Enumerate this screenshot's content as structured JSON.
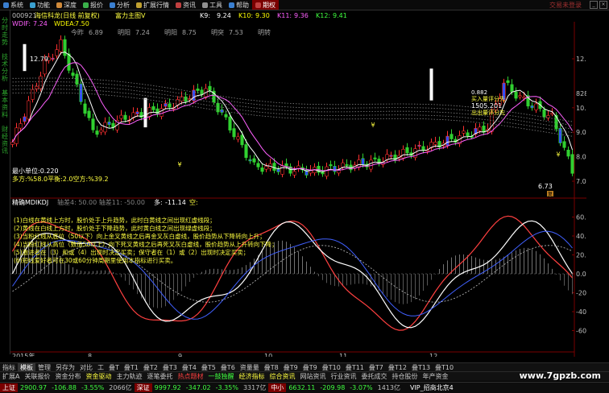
{
  "menu": {
    "items": [
      {
        "label": "系统",
        "color": "#3a7fd0"
      },
      {
        "label": "功能",
        "color": "#3aa0d0"
      },
      {
        "label": "深度",
        "color": "#d08a3a"
      },
      {
        "label": "报价",
        "color": "#3ab04a"
      },
      {
        "label": "分析",
        "color": "#3a7fd0"
      },
      {
        "label": "扩展行情",
        "color": "#c0a030"
      },
      {
        "label": "资讯",
        "color": "#c04040"
      },
      {
        "label": "工具",
        "color": "#909090"
      },
      {
        "label": "帮助",
        "color": "#3a7fd0"
      },
      {
        "label": "期权",
        "color": "#c04040"
      }
    ],
    "watermark": "交易未登录"
  },
  "left_tabs": [
    "分时走势",
    "技术分析",
    "基本资料",
    "财经资讯"
  ],
  "header": {
    "code": "000921",
    "name": "海信科龙(日线 前复权)",
    "indicator": "富力主图V",
    "ma": [
      {
        "label": "K9:",
        "value": "9.24",
        "color": "#ffffff"
      },
      {
        "label": "K10:",
        "value": "9.30",
        "color": "#ffff00"
      },
      {
        "label": "K11:",
        "value": "9.36",
        "color": "#ff60ff"
      },
      {
        "label": "K12:",
        "value": "9.41",
        "color": "#40ff40"
      }
    ],
    "sub": [
      {
        "label": "WDIF:",
        "value": "7.24",
        "color": "#ff60ff"
      },
      {
        "label": "WDEA:",
        "value": "7.50",
        "color": "#ffff00"
      }
    ],
    "row3": [
      {
        "label": "今昨",
        "value": "6.89"
      },
      {
        "label": "明阳",
        "value": "7.24"
      },
      {
        "label": "明阳",
        "value": "8.75"
      },
      {
        "label": "明突",
        "value": "7.53"
      },
      {
        "label": "明转",
        "value": ""
      }
    ]
  },
  "price_chart": {
    "high_label": "12.79",
    "info_lines": [
      "最小单位:0.220",
      "多方:%58.0平衡:2.0空方:%39.2"
    ],
    "right_notes": [
      "0.882",
      "买入量评分先",
      "1505.201",
      "出出量评分先"
    ],
    "low_label": "6.73",
    "low_badge": "复"
  },
  "indicator_panel": {
    "name": "精确MDIKDJ",
    "params": "轴差4: 50.00  轴差11: -50.00",
    "signal_label": "多:",
    "signal_value": "-11.14",
    "signal_empty": "空:",
    "notes": [
      "(1)白线在黄线上方时，股价处于上升趋势，此时白黄线之间出现红虚线段；",
      "(2)黄线在白线上方时，股价处于下降趋势，此时黄白线之间出现绿虚线段；",
      "(3)当粉红线从底位（50以下）向上金叉黄线之后再金叉灰白虚线，股价趋势从下降转向上升；",
      "(4)当粉红线从高位（数值50以上）向下死叉黄线之后再死叉灰白虚线，股价趋势从上升转向下降；",
      "(5)激进者在（3）和或（4）出现时决定买卖；保守者在（1）或（2）出现时决定买卖；",
      "(6)短线爱好者可在30或60分钟周期里使用本指标进行买卖。"
    ]
  },
  "axis": {
    "price_ticks": [
      "12.00",
      "10.00",
      "9.00",
      "8.00",
      "7.00"
    ],
    "top_value": "828",
    "ind_ticks": [
      "60.00",
      "40.00",
      "20.00",
      "0.00",
      "-20.00",
      "-40.00",
      "-60.00"
    ],
    "date_labels": [
      "2015年",
      "8",
      "9",
      "10",
      "11",
      "12"
    ]
  },
  "tabs_row1": [
    "指标",
    "模板",
    "管理",
    "另存为",
    "对比",
    "工",
    "叠T",
    "叠T1",
    "叠T2",
    "叠T3",
    "叠T4",
    "叠T5",
    "叠T6",
    "资量量",
    "叠T8",
    "叠T9",
    "叠T9",
    "叠T10",
    "叠T11",
    "叠T7",
    "叠T12",
    "叠T13",
    "叠T10"
  ],
  "tabs_row2": [
    {
      "label": "扩展A",
      "color": "#c8c8c8"
    },
    {
      "label": "关联报价",
      "color": "#c8c8c8"
    },
    {
      "label": "资金分布",
      "color": "#c8c8c8"
    },
    {
      "label": "资金驱动",
      "color": "#ffff40"
    },
    {
      "label": "主力轨迹",
      "color": "#c8c8c8"
    },
    {
      "label": "逐笔委托",
      "color": "#c8c8c8"
    },
    {
      "label": "热点题材",
      "color": "#ff4040"
    },
    {
      "label": "一鼓独醒",
      "color": "#40ff40"
    },
    {
      "label": "经济指标",
      "color": "#ffff40"
    },
    {
      "label": "综合资讯",
      "color": "#ffff40"
    },
    {
      "label": "网站资讯",
      "color": "#c8c8c8"
    },
    {
      "label": "行业资讯",
      "color": "#c8c8c8"
    },
    {
      "label": "委托成交",
      "color": "#c8c8c8"
    },
    {
      "label": "持仓股份",
      "color": "#c8c8c8"
    },
    {
      "label": "年产资金",
      "color": "#c8c8c8"
    }
  ],
  "status": [
    {
      "label": "上证",
      "value": "2900.97",
      "chg": "-106.88",
      "pct": "-3.55%",
      "vol": "2066亿",
      "color": "#40ff40"
    },
    {
      "label": "深证",
      "value": "9997.92",
      "chg": "-347.02",
      "pct": "-3.35%",
      "vol": "3317亿",
      "color": "#40ff40"
    },
    {
      "label": "中小",
      "value": "6632.11",
      "chg": "-209.98",
      "pct": "-3.07%",
      "vol": "1413亿",
      "color": "#40ff40"
    }
  ],
  "status_right": "VIP_招商北京4",
  "site_watermark": "www.7gpzb.com"
}
